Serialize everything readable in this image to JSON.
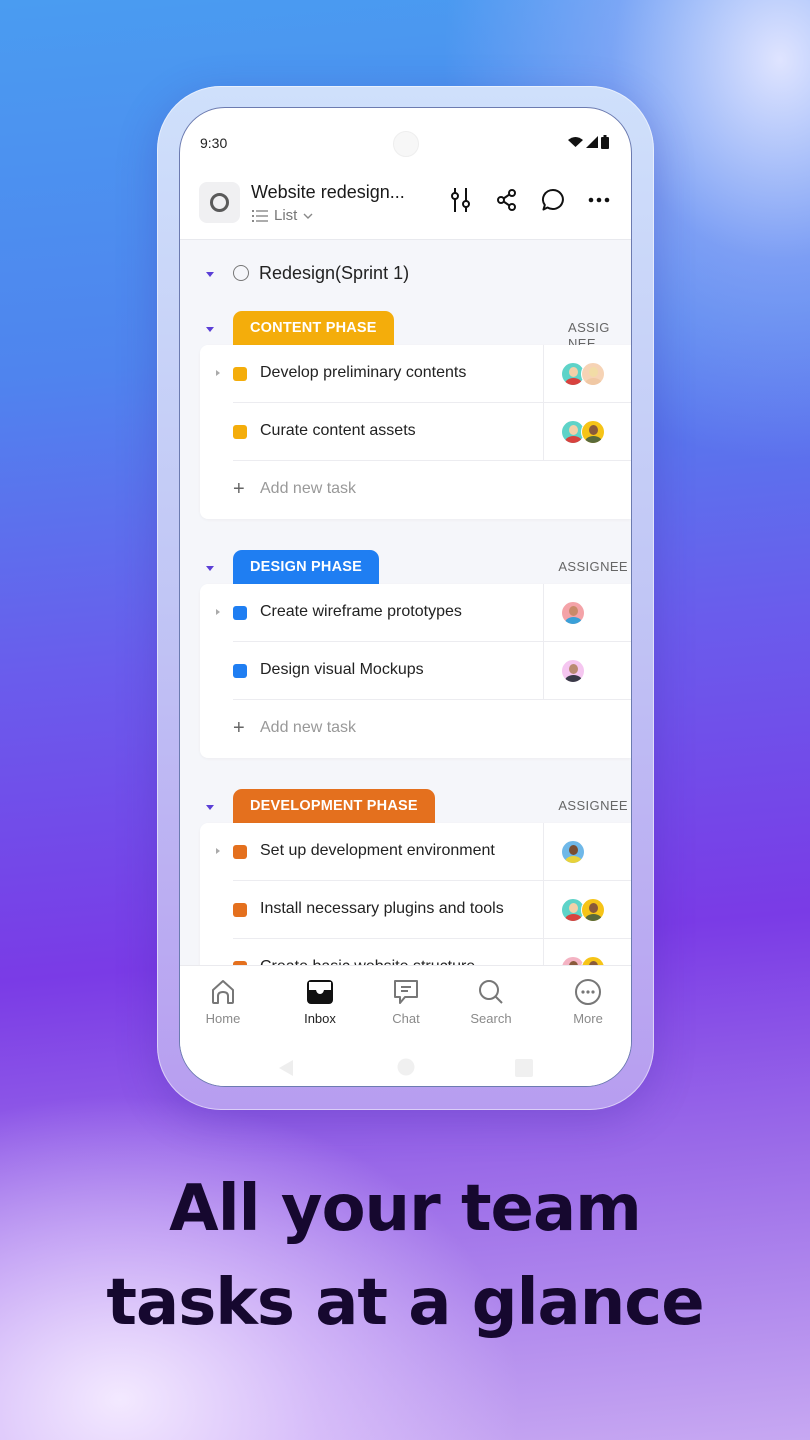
{
  "status_bar": {
    "time": "9:30",
    "icons": [
      "wifi-icon",
      "signal-icon",
      "battery-icon"
    ]
  },
  "header": {
    "project_title": "Website redesign...",
    "view_label": "List",
    "actions": [
      "filter-sliders-icon",
      "share-icon",
      "comment-icon",
      "more-horizontal-icon"
    ]
  },
  "sprint": {
    "label": "Redesign(Sprint 1)"
  },
  "groups": [
    {
      "name": "CONTENT PHASE",
      "color": "#f4ad0b",
      "assignee_header": "ASSIG\nNEE",
      "tasks": [
        {
          "name": "Develop preliminary contents",
          "has_subtasks": true,
          "assignees": [
            "woman-blonde-teal",
            "woman-blonde-peach"
          ]
        },
        {
          "name": "Curate content assets",
          "has_subtasks": false,
          "assignees": [
            "woman-blonde-teal",
            "man-dark-yellow"
          ]
        }
      ],
      "add_label": "Add new task"
    },
    {
      "name": "DESIGN PHASE",
      "color": "#1f7ef2",
      "assignee_header": "ASSIGNEE",
      "tasks": [
        {
          "name": "Create wireframe prototypes",
          "has_subtasks": true,
          "assignees": [
            "man-blue-pink"
          ]
        },
        {
          "name": "Design visual Mockups",
          "has_subtasks": false,
          "assignees": [
            "man-suit-pink"
          ]
        }
      ],
      "add_label": "Add new task"
    },
    {
      "name": "DEVELOPMENT PHASE",
      "color": "#e4701e",
      "assignee_header": "ASSIGNEE",
      "tasks": [
        {
          "name": "Set up development environment",
          "has_subtasks": true,
          "assignees": [
            "man-blue-yellow"
          ]
        },
        {
          "name": "Install necessary plugins and tools",
          "has_subtasks": false,
          "assignees": [
            "woman-blonde-teal",
            "man-dark-yellow"
          ]
        },
        {
          "name": "Create basic website structure",
          "has_subtasks": false,
          "assignees": [
            "woman-pink",
            "man-dark-yellow"
          ]
        }
      ]
    }
  ],
  "bottom_nav": [
    {
      "label": "Home",
      "icon": "home-icon",
      "active": false
    },
    {
      "label": "Inbox",
      "icon": "inbox-icon",
      "active": true
    },
    {
      "label": "Chat",
      "icon": "chat-icon",
      "active": false
    },
    {
      "label": "Search",
      "icon": "search-icon",
      "active": false
    },
    {
      "label": "More",
      "icon": "more-circle-icon",
      "active": false
    }
  ],
  "headline": {
    "line1": "All your team",
    "line2": "tasks at a glance"
  }
}
